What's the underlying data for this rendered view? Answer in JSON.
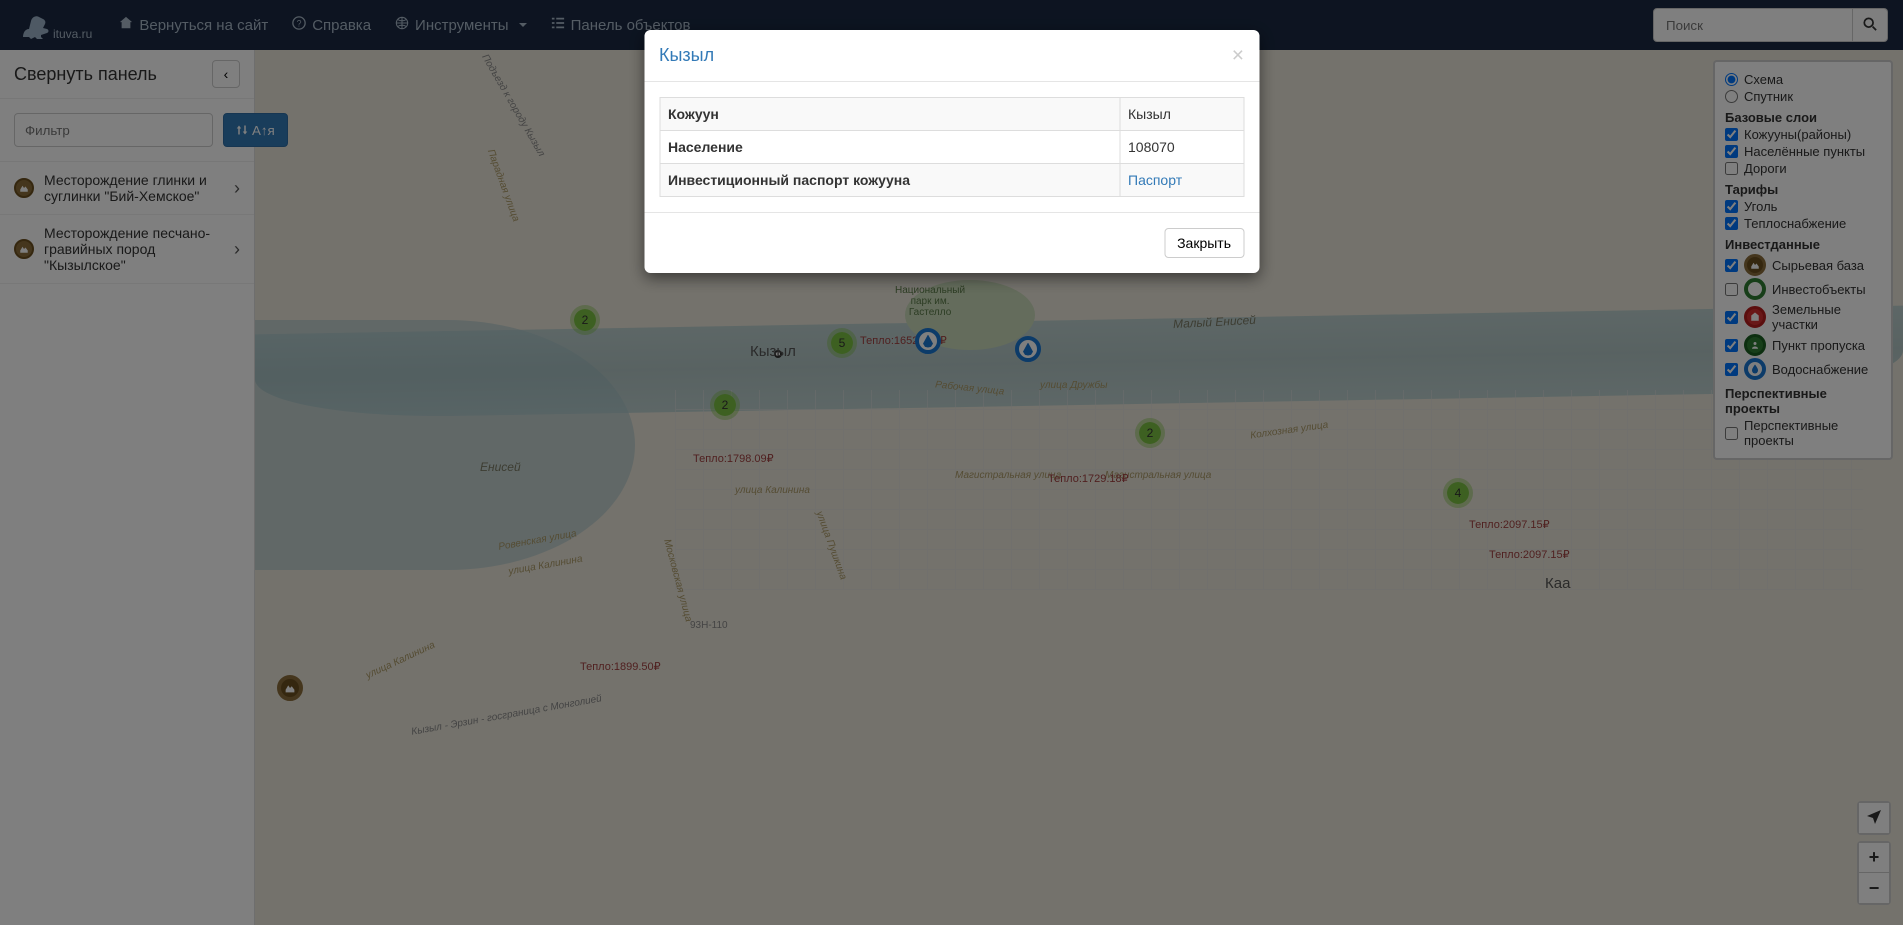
{
  "brand": "ituva.ru",
  "nav": {
    "back": "Вернуться на сайт",
    "help": "Справка",
    "tools": "Инструменты",
    "objects": "Панель объектов"
  },
  "search": {
    "placeholder": "Поиск"
  },
  "sidebar": {
    "title": "Свернуть панель",
    "filter_placeholder": "Фильтр",
    "sort_label": "А↑я",
    "items": [
      {
        "label": "Месторождение глинки и суглинки \"Бий-Хемское\""
      },
      {
        "label": "Месторождение песчано-гравийных пород \"Кызылское\""
      }
    ]
  },
  "layers": {
    "mode": {
      "scheme": "Схема",
      "satellite": "Спутник"
    },
    "base_title": "Базовые слои",
    "base": {
      "districts": "Кожууны(районы)",
      "settlements": "Населённые пункты",
      "roads": "Дороги"
    },
    "tariffs_title": "Тарифы",
    "tariffs": {
      "coal": "Уголь",
      "heat": "Теплоснабжение"
    },
    "invest_title": "Инвестданные",
    "invest": {
      "raw": "Сырьевая база",
      "objects": "Инвестобъекты",
      "land": "Земельные участки",
      "checkpoint": "Пункт пропуска",
      "water": "Водоснабжение"
    },
    "prospect_title": "Перспективные проекты",
    "prospect": {
      "projects": "Перспективные проекты"
    }
  },
  "map": {
    "city": "Кызыл",
    "caa": "Каа",
    "rivers": {
      "yenisei": "Енисей",
      "m_yenisei": "Малый Енисей"
    },
    "streets": {
      "druzhby": "улица Дружбы",
      "kalinina": "улица Калинина",
      "magistralnaya": "Магистральная улица",
      "rabochaya": "Рабочая улица",
      "rovenskaya": "Ровенская улица",
      "kalinina2": "улица Калинина",
      "kolhoznaya": "Колхозная улица",
      "moskovskaya": "Московская улица",
      "paradnaya": "Парадная улица",
      "pushkina": "улица Пушкина",
      "93h110": "93Н-110",
      "border": "Кызыл - Эрзин - госграница с Монголией",
      "podyem": "Подъезд к городу Кызыл"
    },
    "park": {
      "line1": "Национальный",
      "line2": "парк им.",
      "line3": "Гастелло"
    },
    "tariffs": {
      "t1": "Тепло:1652.___₽",
      "t2": "Тепло:1798.09₽",
      "t3": "Тепло:1729.18₽",
      "t4": "Тепло:1899.50₽",
      "t5": "Тепло:2097.15₽",
      "t6": "Тепло:2097.15₽"
    },
    "clusters": {
      "c1": "2",
      "c2": "5",
      "c3": "2",
      "c4": "2",
      "c5": "4"
    }
  },
  "modal": {
    "title": "Кызыл",
    "rows": {
      "district_label": "Кожуун",
      "district_value": "Кызыл",
      "population_label": "Население",
      "population_value": "108070",
      "passport_label": "Инвестиционный паспорт кожууна",
      "passport_link": "Паспорт"
    },
    "close": "Закрыть"
  },
  "controls": {
    "plus": "+",
    "minus": "−"
  }
}
